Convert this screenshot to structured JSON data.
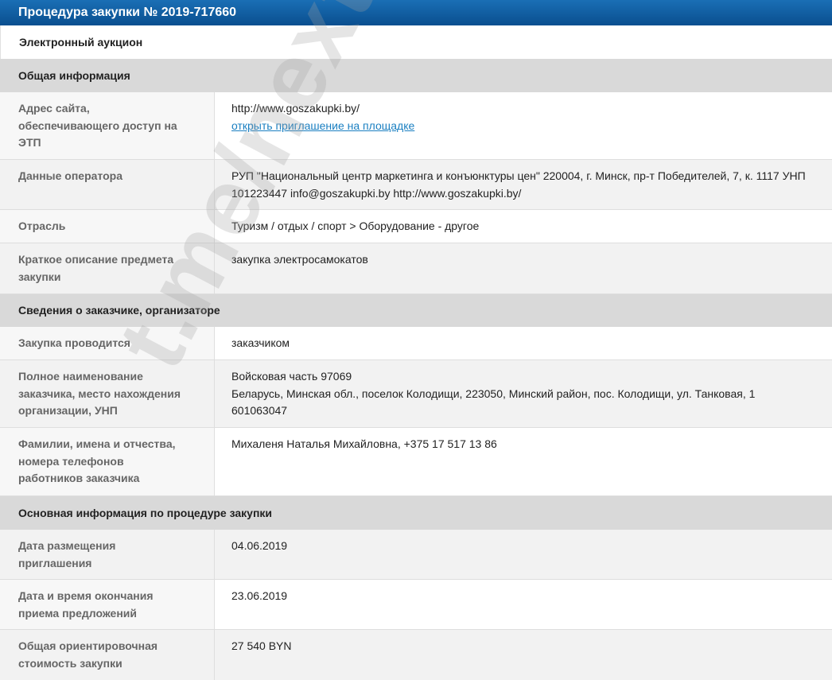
{
  "header": {
    "title": "Процедура закупки № 2019-717660",
    "procedure_type": "Электронный аукцион"
  },
  "sections": {
    "general": {
      "title": "Общая информация",
      "rows": {
        "etp_address": {
          "label": [
            "Адрес сайта,",
            "обеспечивающего доступ на",
            "ЭТП"
          ],
          "value": "http://www.goszakupki.by/",
          "link": "открыть приглашение на площадке"
        },
        "operator": {
          "label": [
            "Данные оператора"
          ],
          "value": [
            "РУП \"Национальный центр маркетинга и конъюнктуры цен\" 220004, г. Минск, пр-т Победителей, 7, к. 1117 УНП",
            "101223447 info@goszakupki.by http://www.goszakupki.by/"
          ]
        },
        "industry": {
          "label": [
            "Отрасль"
          ],
          "value": "Туризм / отдых / спорт > Оборудование - другое"
        },
        "description": {
          "label": [
            "Краткое описание предмета",
            "закупки"
          ],
          "value": "закупка электросамокатов"
        }
      }
    },
    "customer": {
      "title": "Сведения о заказчике, организаторе",
      "rows": {
        "conducted_by": {
          "label": [
            "Закупка проводится"
          ],
          "value": "заказчиком"
        },
        "full_name": {
          "label": [
            "Полное наименование",
            "заказчика, место нахождения",
            "организации, УНП"
          ],
          "value": [
            "Войсковая часть 97069",
            "Беларусь, Минская обл., поселок Колодищи, 223050, Минский район, пос. Колодищи, ул. Танковая, 1",
            "601063047"
          ]
        },
        "contacts": {
          "label": [
            "Фамилии, имена и отчества,",
            "номера телефонов",
            "работников заказчика"
          ],
          "value": "Михаленя Наталья Михайловна, +375 17 517 13 86"
        }
      }
    },
    "procedure": {
      "title": "Основная информация по процедуре закупки",
      "rows": {
        "posted": {
          "label": [
            "Дата размещения",
            "приглашения"
          ],
          "value": "04.06.2019"
        },
        "deadline": {
          "label": [
            "Дата и время окончания",
            "приема предложений"
          ],
          "value": "23.06.2019"
        },
        "cost": {
          "label": [
            "Общая ориентировочная",
            "стоимость закупки"
          ],
          "value": "27 540 BYN"
        }
      }
    }
  },
  "watermark": "t.me/nexta_tv",
  "colors": {
    "header_blue": "#0a4f8f",
    "link": "#1a7fc1",
    "section_bg": "#d9d9d9"
  }
}
